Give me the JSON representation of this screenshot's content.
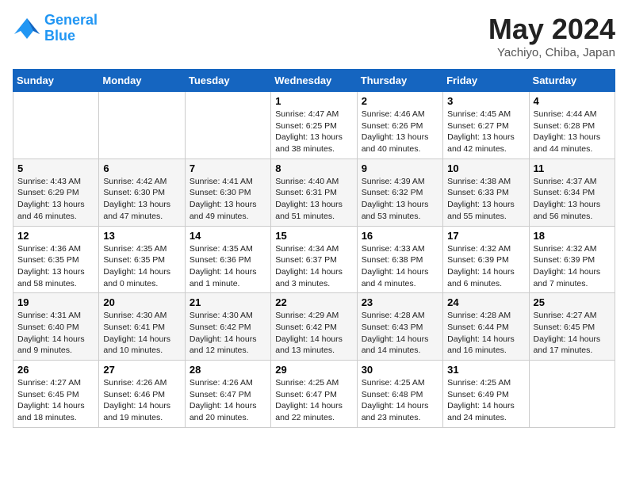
{
  "header": {
    "logo_line1": "General",
    "logo_line2": "Blue",
    "month_title": "May 2024",
    "location": "Yachiyo, Chiba, Japan"
  },
  "days_of_week": [
    "Sunday",
    "Monday",
    "Tuesday",
    "Wednesday",
    "Thursday",
    "Friday",
    "Saturday"
  ],
  "weeks": [
    [
      {
        "day": "",
        "info": ""
      },
      {
        "day": "",
        "info": ""
      },
      {
        "day": "",
        "info": ""
      },
      {
        "day": "1",
        "info": "Sunrise: 4:47 AM\nSunset: 6:25 PM\nDaylight: 13 hours\nand 38 minutes."
      },
      {
        "day": "2",
        "info": "Sunrise: 4:46 AM\nSunset: 6:26 PM\nDaylight: 13 hours\nand 40 minutes."
      },
      {
        "day": "3",
        "info": "Sunrise: 4:45 AM\nSunset: 6:27 PM\nDaylight: 13 hours\nand 42 minutes."
      },
      {
        "day": "4",
        "info": "Sunrise: 4:44 AM\nSunset: 6:28 PM\nDaylight: 13 hours\nand 44 minutes."
      }
    ],
    [
      {
        "day": "5",
        "info": "Sunrise: 4:43 AM\nSunset: 6:29 PM\nDaylight: 13 hours\nand 46 minutes."
      },
      {
        "day": "6",
        "info": "Sunrise: 4:42 AM\nSunset: 6:30 PM\nDaylight: 13 hours\nand 47 minutes."
      },
      {
        "day": "7",
        "info": "Sunrise: 4:41 AM\nSunset: 6:30 PM\nDaylight: 13 hours\nand 49 minutes."
      },
      {
        "day": "8",
        "info": "Sunrise: 4:40 AM\nSunset: 6:31 PM\nDaylight: 13 hours\nand 51 minutes."
      },
      {
        "day": "9",
        "info": "Sunrise: 4:39 AM\nSunset: 6:32 PM\nDaylight: 13 hours\nand 53 minutes."
      },
      {
        "day": "10",
        "info": "Sunrise: 4:38 AM\nSunset: 6:33 PM\nDaylight: 13 hours\nand 55 minutes."
      },
      {
        "day": "11",
        "info": "Sunrise: 4:37 AM\nSunset: 6:34 PM\nDaylight: 13 hours\nand 56 minutes."
      }
    ],
    [
      {
        "day": "12",
        "info": "Sunrise: 4:36 AM\nSunset: 6:35 PM\nDaylight: 13 hours\nand 58 minutes."
      },
      {
        "day": "13",
        "info": "Sunrise: 4:35 AM\nSunset: 6:35 PM\nDaylight: 14 hours\nand 0 minutes."
      },
      {
        "day": "14",
        "info": "Sunrise: 4:35 AM\nSunset: 6:36 PM\nDaylight: 14 hours\nand 1 minute."
      },
      {
        "day": "15",
        "info": "Sunrise: 4:34 AM\nSunset: 6:37 PM\nDaylight: 14 hours\nand 3 minutes."
      },
      {
        "day": "16",
        "info": "Sunrise: 4:33 AM\nSunset: 6:38 PM\nDaylight: 14 hours\nand 4 minutes."
      },
      {
        "day": "17",
        "info": "Sunrise: 4:32 AM\nSunset: 6:39 PM\nDaylight: 14 hours\nand 6 minutes."
      },
      {
        "day": "18",
        "info": "Sunrise: 4:32 AM\nSunset: 6:39 PM\nDaylight: 14 hours\nand 7 minutes."
      }
    ],
    [
      {
        "day": "19",
        "info": "Sunrise: 4:31 AM\nSunset: 6:40 PM\nDaylight: 14 hours\nand 9 minutes."
      },
      {
        "day": "20",
        "info": "Sunrise: 4:30 AM\nSunset: 6:41 PM\nDaylight: 14 hours\nand 10 minutes."
      },
      {
        "day": "21",
        "info": "Sunrise: 4:30 AM\nSunset: 6:42 PM\nDaylight: 14 hours\nand 12 minutes."
      },
      {
        "day": "22",
        "info": "Sunrise: 4:29 AM\nSunset: 6:42 PM\nDaylight: 14 hours\nand 13 minutes."
      },
      {
        "day": "23",
        "info": "Sunrise: 4:28 AM\nSunset: 6:43 PM\nDaylight: 14 hours\nand 14 minutes."
      },
      {
        "day": "24",
        "info": "Sunrise: 4:28 AM\nSunset: 6:44 PM\nDaylight: 14 hours\nand 16 minutes."
      },
      {
        "day": "25",
        "info": "Sunrise: 4:27 AM\nSunset: 6:45 PM\nDaylight: 14 hours\nand 17 minutes."
      }
    ],
    [
      {
        "day": "26",
        "info": "Sunrise: 4:27 AM\nSunset: 6:45 PM\nDaylight: 14 hours\nand 18 minutes."
      },
      {
        "day": "27",
        "info": "Sunrise: 4:26 AM\nSunset: 6:46 PM\nDaylight: 14 hours\nand 19 minutes."
      },
      {
        "day": "28",
        "info": "Sunrise: 4:26 AM\nSunset: 6:47 PM\nDaylight: 14 hours\nand 20 minutes."
      },
      {
        "day": "29",
        "info": "Sunrise: 4:25 AM\nSunset: 6:47 PM\nDaylight: 14 hours\nand 22 minutes."
      },
      {
        "day": "30",
        "info": "Sunrise: 4:25 AM\nSunset: 6:48 PM\nDaylight: 14 hours\nand 23 minutes."
      },
      {
        "day": "31",
        "info": "Sunrise: 4:25 AM\nSunset: 6:49 PM\nDaylight: 14 hours\nand 24 minutes."
      },
      {
        "day": "",
        "info": ""
      }
    ]
  ]
}
